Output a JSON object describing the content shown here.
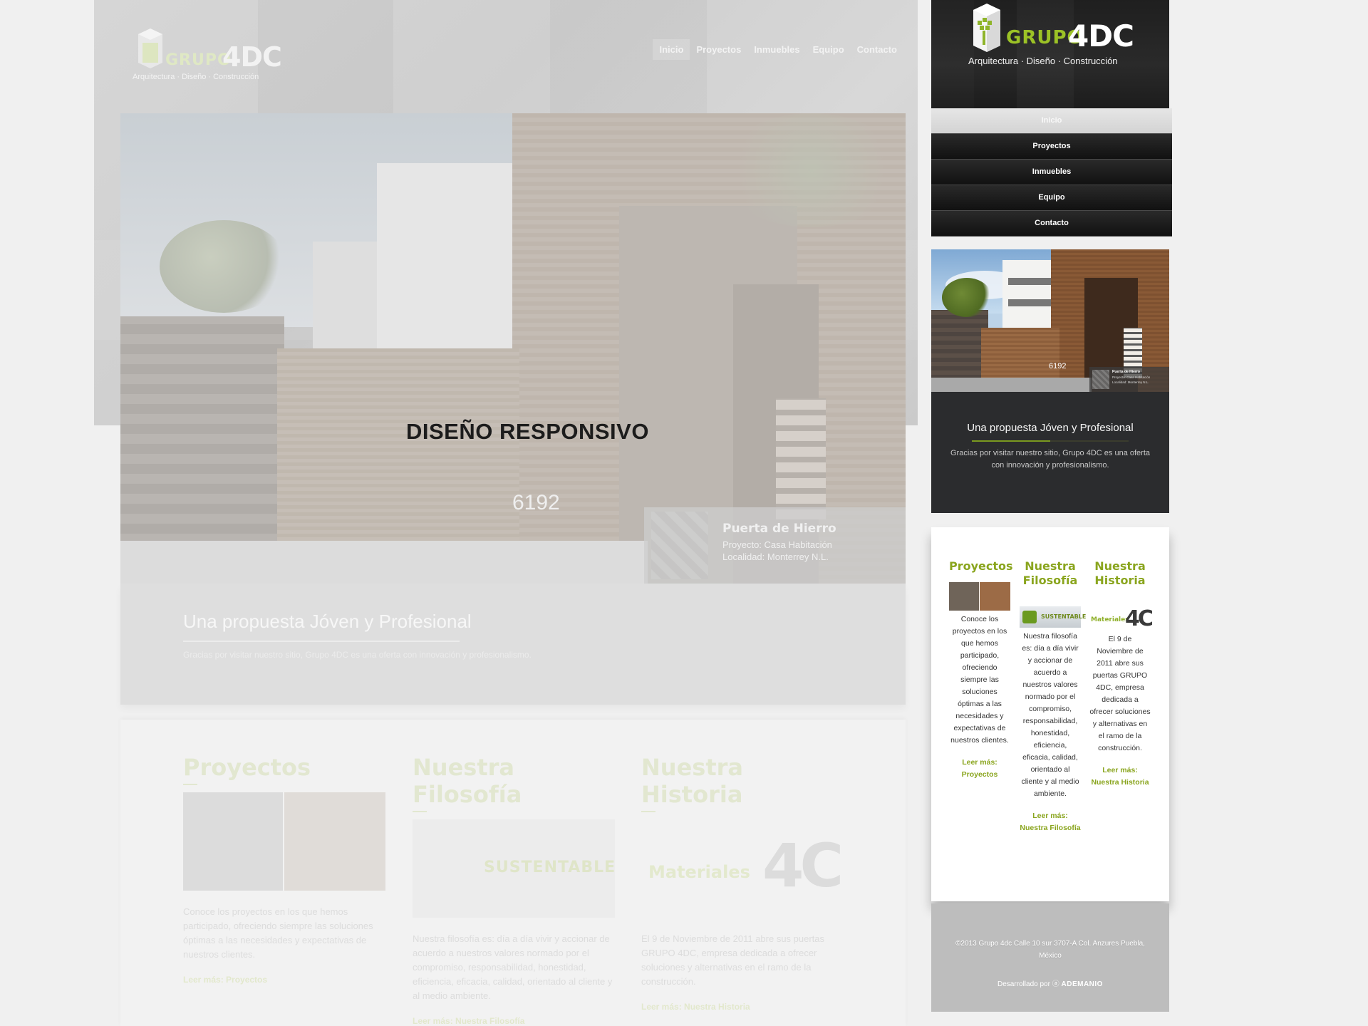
{
  "headline": "DISEÑO RESPONSIVO",
  "brand": {
    "grupo": "GRUPO",
    "fdc": "4DC",
    "tagline": "Arquitectura · Diseño · Construcción"
  },
  "nav": [
    "Inicio",
    "Proyectos",
    "Inmuebles",
    "Equipo",
    "Contacto"
  ],
  "hero": {
    "number": "6192",
    "caption_title": "Puerta de Hierro",
    "caption_project": "Proyecto: Casa Habitación",
    "caption_location": "Localidad: Monterrey N.L."
  },
  "intro": {
    "title": "Una propuesta Jóven y Profesional",
    "text": "Gracias por visitar nuestro sitio, Grupo 4DC es una oferta con innovación y profesionalismo."
  },
  "columns": [
    {
      "title": "Proyectos",
      "text": "Conoce los proyectos en los que hemos participado, ofreciendo siempre las soluciones óptimas a las necesidades y expectativas de nuestros clientes.",
      "more": "Leer más: Proyectos"
    },
    {
      "title": "Nuestra Filosofía",
      "text": "Nuestra filosofía es: día a día vivir y accionar de acuerdo a nuestros valores  normado por el compromiso, responsabilidad, honestidad, eficiencia, eficacia, calidad, orientado al cliente y al medio ambiente.",
      "more": "Leer más: Nuestra Filosofía",
      "image_text": "SUSTENTABLE"
    },
    {
      "title": "Nuestra Historia",
      "text": "El 9 de Noviembre de 2011 abre sus puertas GRUPO 4DC, empresa dedicada a ofrecer soluciones y alternativas en el ramo de la construcción.",
      "more": "Leer más: Nuestra Historia",
      "image_text": "Materiales",
      "image_logo": "4C"
    }
  ],
  "footer": {
    "address": "©2013 Grupo 4dc Calle 10 sur 3707-A Col. Anzures Puebla, México",
    "developed_by": "Desarrollado por",
    "developer": "ADEMANIO"
  },
  "colors": {
    "accent_green": "#8aa51e",
    "dark_header": "#1f1f1f"
  }
}
